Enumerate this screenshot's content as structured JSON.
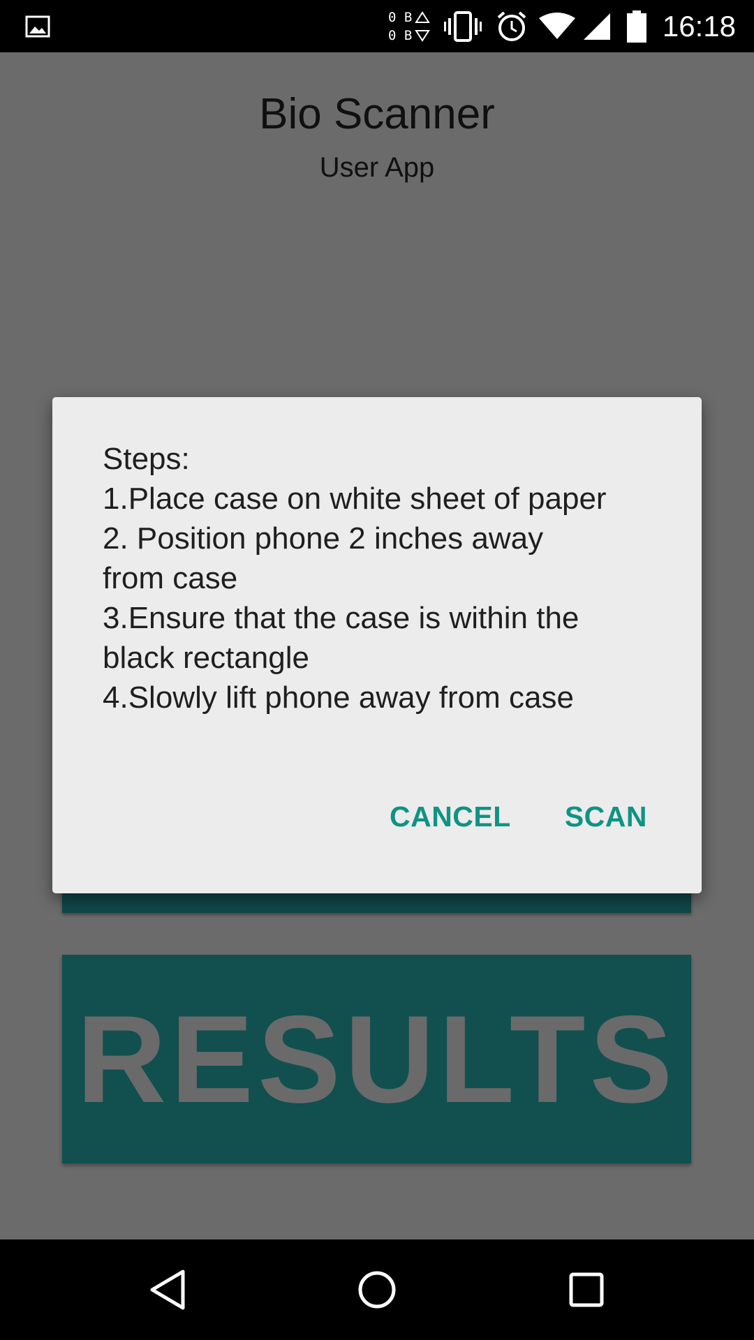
{
  "status_bar": {
    "time": "16:18",
    "data_up": "0 B",
    "data_down": "0 B",
    "icons": [
      "image-icon",
      "data-activity-icon",
      "vibrate-icon",
      "alarm-icon",
      "wifi-icon",
      "cell-signal-icon",
      "battery-icon"
    ]
  },
  "app": {
    "title": "Bio Scanner",
    "subtitle": "User App",
    "results_label": "RESULTS"
  },
  "dialog": {
    "lines": [
      "Steps:",
      "1.Place case on white sheet of paper",
      "2. Position phone 2 inches away",
      "from case",
      "3.Ensure that the case is within the",
      "black rectangle",
      "4.Slowly lift phone away from case"
    ],
    "cancel_label": "CANCEL",
    "scan_label": "SCAN",
    "accent_color": "#0f9384"
  },
  "nav_bar": {
    "icons": [
      "back-icon",
      "home-icon",
      "recents-icon"
    ]
  }
}
